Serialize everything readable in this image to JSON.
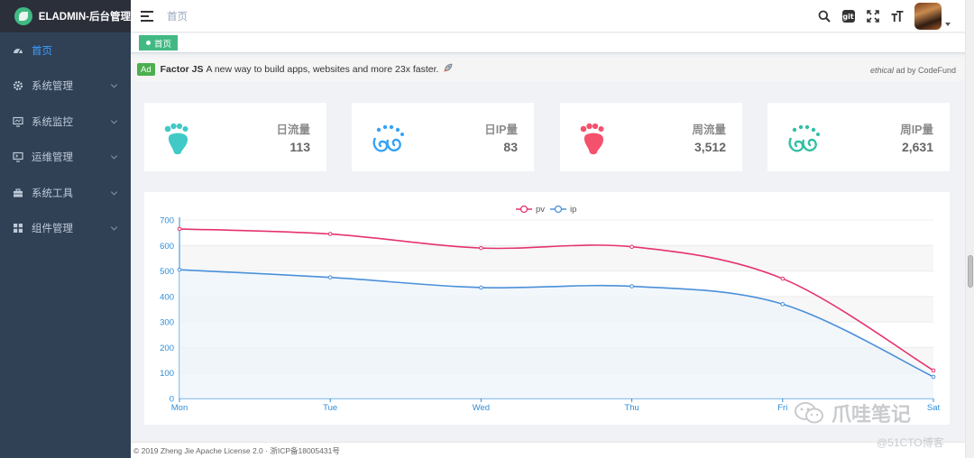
{
  "app": {
    "title": "ELADMIN-后台管理"
  },
  "sidebar": {
    "items": [
      {
        "label": "首页",
        "icon": "dashboard-icon",
        "active": true
      },
      {
        "label": "系统管理",
        "icon": "gear-icon"
      },
      {
        "label": "系统监控",
        "icon": "monitor-icon"
      },
      {
        "label": "运维管理",
        "icon": "terminal-icon"
      },
      {
        "label": "系统工具",
        "icon": "toolbox-icon"
      },
      {
        "label": "组件管理",
        "icon": "grid-icon"
      }
    ]
  },
  "header": {
    "breadcrumb": "首页",
    "icons": [
      "search-icon",
      "git-icon",
      "fullscreen-icon",
      "font-size-icon"
    ],
    "git_label": "git"
  },
  "tags": [
    {
      "label": "首页",
      "active": true
    }
  ],
  "ad": {
    "badge": "Ad",
    "name": "Factor JS",
    "text": "A new way to build apps, websites and more 23x faster.",
    "credit_italic": "ethical",
    "credit_rest": " ad by CodeFund"
  },
  "stats": [
    {
      "label": "日流量",
      "value": "113",
      "icon": "footprint-icon",
      "color": "#40c9c6"
    },
    {
      "label": "日IP量",
      "value": "83",
      "icon": "swirl-icon",
      "color": "#36a3f7"
    },
    {
      "label": "周流量",
      "value": "3,512",
      "icon": "footprint-icon",
      "color": "#f4516c"
    },
    {
      "label": "周IP量",
      "value": "2,631",
      "icon": "swirl-icon",
      "color": "#34bfa3"
    }
  ],
  "chart_data": {
    "type": "line",
    "categories": [
      "Mon",
      "Tue",
      "Wed",
      "Thu",
      "Fri",
      "Sat"
    ],
    "series": [
      {
        "name": "pv",
        "values": [
          665,
          645,
          590,
          595,
          470,
          110
        ],
        "color": "#e5326f"
      },
      {
        "name": "ip",
        "values": [
          505,
          475,
          435,
          440,
          370,
          85
        ],
        "color": "#4a90d9"
      }
    ],
    "yticks": [
      0,
      100,
      200,
      300,
      400,
      500,
      600,
      700
    ],
    "ylim": [
      0,
      700
    ],
    "legend": "top-center",
    "grid": "horizontal-bands"
  },
  "footer": {
    "text": "© 2019 Zheng Jie Apache License 2.0 · 浙ICP备18005431号"
  },
  "watermark": {
    "brand": "爪哇笔记",
    "site": "@51CTO博客"
  }
}
